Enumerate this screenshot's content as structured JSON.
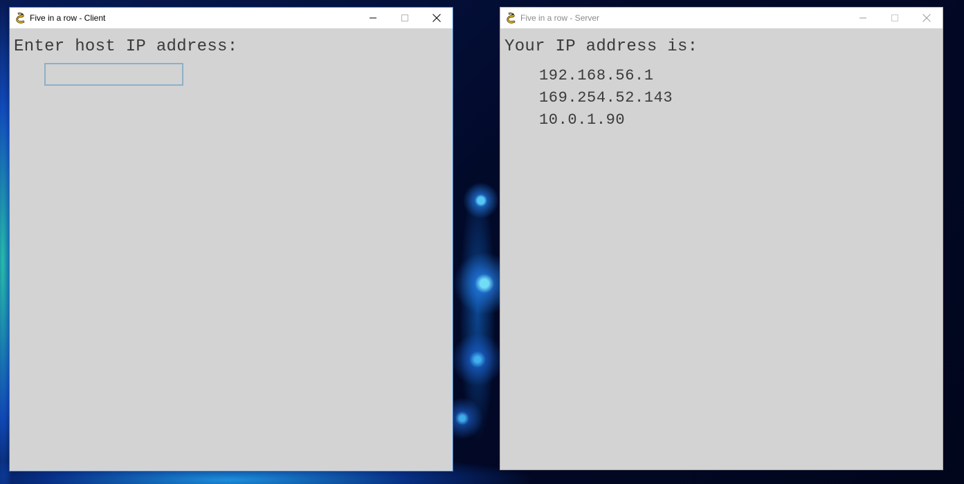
{
  "desktop": {
    "wallpaper": "fractal-blue"
  },
  "client_window": {
    "title": "Five in a row - Client",
    "icon": "pygame-snake-icon",
    "prompt": "Enter host IP address:",
    "ip_input": {
      "value": "",
      "placeholder": ""
    },
    "controls": [
      "minimize",
      "maximize",
      "close"
    ]
  },
  "server_window": {
    "title": "Five in a row - Server",
    "icon": "pygame-snake-icon",
    "heading": "Your IP address is:",
    "ip_addresses": [
      "192.168.56.1",
      "169.254.52.143",
      "10.0.1.90"
    ],
    "controls": [
      "minimize",
      "maximize",
      "close"
    ]
  },
  "colors": {
    "window_bg": "#d3d3d3",
    "text": "#3a3a3a",
    "active_border": "#2b79d6",
    "input_border": "#8db0c7"
  }
}
